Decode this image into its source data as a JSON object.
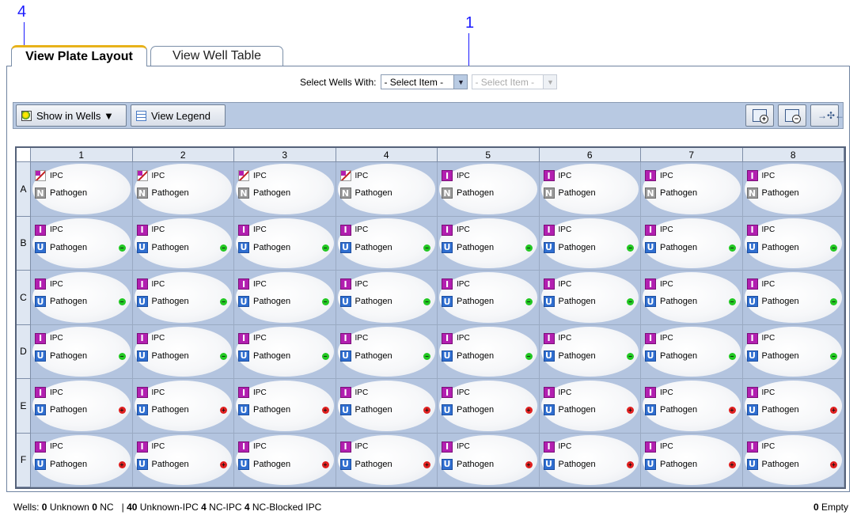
{
  "callouts": {
    "left": "4",
    "right": "1"
  },
  "tabs": {
    "active": "View Plate Layout",
    "inactive": "View Well Table"
  },
  "select": {
    "label": "Select Wells With:",
    "first": "- Select Item -",
    "second": "- Select Item -"
  },
  "toolbar": {
    "show_in_wells": "Show in Wells ▼",
    "view_legend": "View Legend"
  },
  "plate": {
    "columns": [
      "1",
      "2",
      "3",
      "4",
      "5",
      "6",
      "7",
      "8"
    ],
    "rows": [
      "A",
      "B",
      "C",
      "D",
      "E",
      "F"
    ],
    "target1": "IPC",
    "target2": "Pathogen"
  },
  "status": {
    "wells_label": "Wells:",
    "unknown_count": "0",
    "unknown_label": "Unknown",
    "nc_count": "0",
    "nc_label": "NC",
    "sep": "|",
    "unk_ipc_count": "40",
    "unk_ipc_label": "Unknown-IPC",
    "nc_ipc_count": "4",
    "nc_ipc_label": "NC-IPC",
    "ncb_count": "4",
    "ncb_label": "NC-Blocked IPC",
    "empty_count": "0",
    "empty_label": "Empty"
  },
  "colors": {
    "accent": "#e8b21a",
    "plate_bg": "#b3c4df",
    "ipc_badge": "#b21fb0",
    "pathogen_badge": "#2f6ed0",
    "nc_badge": "#9a9a9a",
    "positive": "#e02020",
    "negative": "#22c822"
  },
  "icons": [
    "show-in-wells-icon",
    "legend-icon",
    "zoom-in-icon",
    "zoom-out-icon",
    "fit-icon"
  ]
}
